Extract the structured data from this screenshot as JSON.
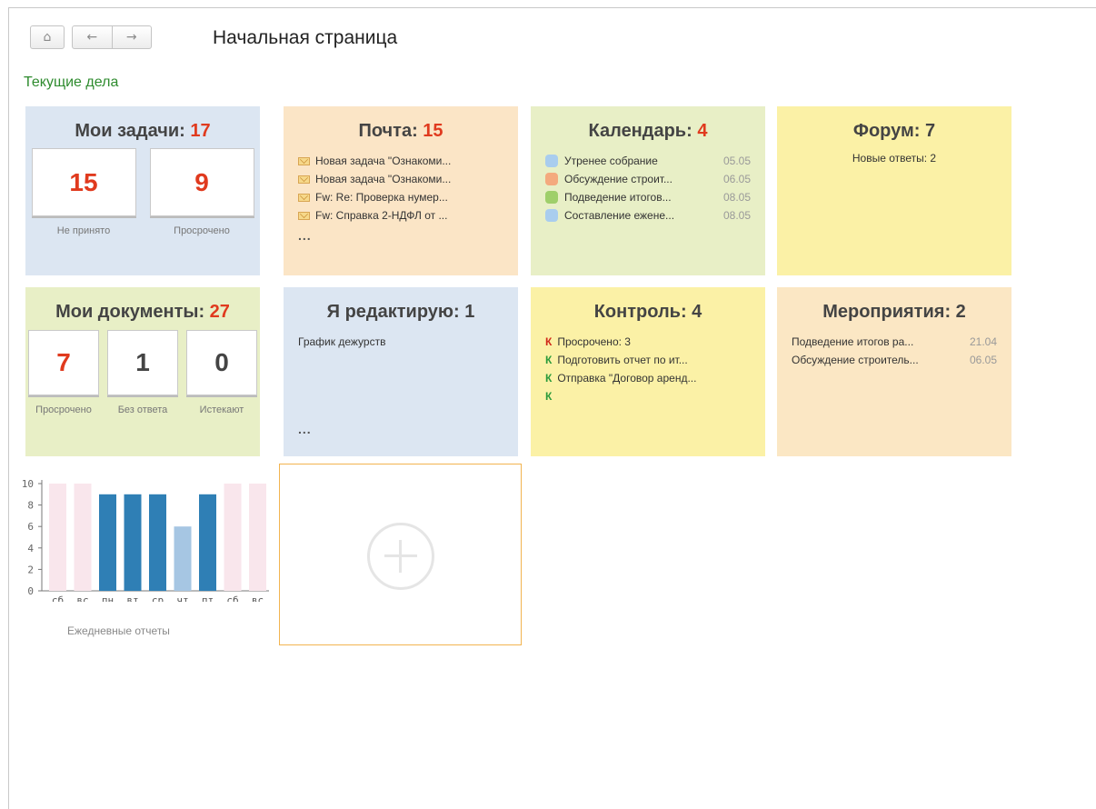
{
  "page": {
    "title": "Начальная страница",
    "section": "Текущие дела"
  },
  "nav": {
    "home": "⌂",
    "back": "←",
    "forward": "→"
  },
  "tiles": {
    "tasks": {
      "title": "Мои задачи: ",
      "count": "17",
      "counters": [
        {
          "value": "15",
          "label": "Не принято"
        },
        {
          "value": "9",
          "label": "Просрочено"
        }
      ]
    },
    "mail": {
      "title": "Почта: ",
      "count": "15",
      "items": [
        "Новая задача \"Ознакоми...",
        "Новая задача \"Ознакоми...",
        "Fw: Re: Проверка нумер...",
        "Fw: Справка 2-НДФЛ от ..."
      ],
      "more": "..."
    },
    "calendar": {
      "title": "Календарь: ",
      "count": "4",
      "items": [
        {
          "text": "Утренее собрание",
          "date": "05.05",
          "color": "#a9cdee"
        },
        {
          "text": "Обсуждение строит...",
          "date": "06.05",
          "color": "#f4aa7e"
        },
        {
          "text": "Подведение итогов...",
          "date": "08.05",
          "color": "#9fcf6a"
        },
        {
          "text": "Составление ежене...",
          "date": "08.05",
          "color": "#a9cdee"
        }
      ]
    },
    "forum": {
      "title": "Форум: 7",
      "text": "Новые ответы: 2"
    },
    "documents": {
      "title": "Мои документы: ",
      "count": "27",
      "counters": [
        {
          "value": "7",
          "label": "Просрочено"
        },
        {
          "value": "1",
          "label": "Без ответа"
        },
        {
          "value": "0",
          "label": "Истекают"
        }
      ]
    },
    "editing": {
      "title": "Я редактирую: 1",
      "items": [
        "График дежурств"
      ],
      "more": "..."
    },
    "control": {
      "title": "Контроль: 4",
      "mark": "К",
      "items": [
        {
          "text": "Просрочено: 3",
          "mark_color": "#d02818"
        },
        {
          "text": "Подготовить отчет по ит...",
          "mark_color": "#2a9a3a"
        },
        {
          "text": "Отправка \"Договор аренд...",
          "mark_color": "#2a9a3a"
        },
        {
          "text": "",
          "mark_color": "#2a9a3a"
        }
      ]
    },
    "events": {
      "title": "Мероприятия: 2",
      "items": [
        {
          "text": "Подведение итогов ра...",
          "date": "21.04"
        },
        {
          "text": "Обсуждение строитель...",
          "date": "06.05"
        }
      ]
    }
  },
  "chart_data": {
    "type": "bar",
    "title": "Ежедневные отчеты",
    "xlabel": "",
    "ylabel": "",
    "ylim": [
      0,
      10
    ],
    "yticks": [
      0,
      2,
      4,
      6,
      8,
      10
    ],
    "categories": [
      "сб",
      "вс",
      "пн",
      "вт",
      "ср",
      "чт",
      "пт",
      "сб",
      "вс"
    ],
    "values": [
      10,
      10,
      9,
      9,
      9,
      6,
      9,
      10,
      10
    ],
    "bar_colors": [
      "#f9e6ec",
      "#f9e6ec",
      "#2f7fb5",
      "#2f7fb5",
      "#2f7fb5",
      "#a6c6e3",
      "#2f7fb5",
      "#f9e6ec",
      "#f9e6ec"
    ],
    "grid": false,
    "legend": "none"
  }
}
